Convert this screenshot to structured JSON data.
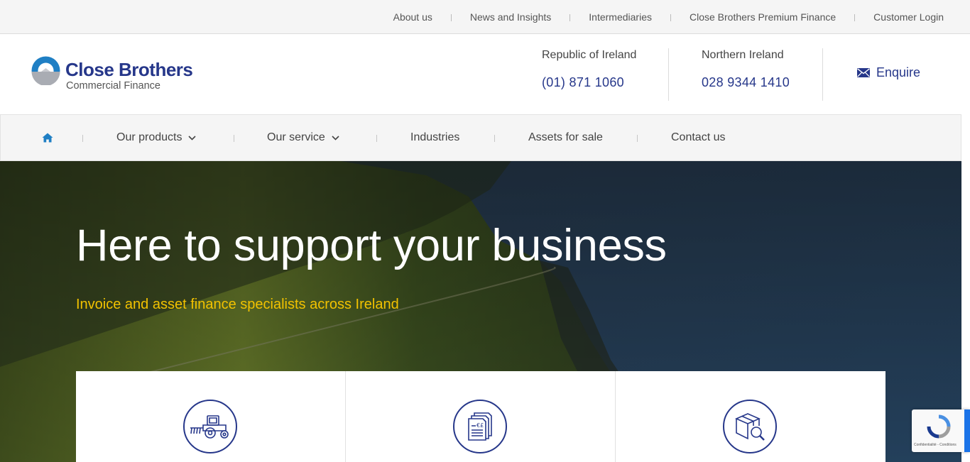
{
  "topbar": {
    "links": [
      "About us",
      "News and Insights",
      "Intermediaries",
      "Close Brothers Premium Finance",
      "Customer Login"
    ]
  },
  "logo": {
    "name": "Close Brothers",
    "subtitle": "Commercial Finance"
  },
  "contacts": {
    "roi": {
      "region": "Republic of Ireland",
      "phone": "(01) 871 1060"
    },
    "ni": {
      "region": "Northern Ireland",
      "phone": "028 9344 1410"
    }
  },
  "enquire": {
    "label": "Enquire",
    "icon": "envelope-icon"
  },
  "nav": {
    "home_icon": "home-icon",
    "products": "Our products",
    "service": "Our service",
    "industries": "Industries",
    "assets": "Assets for sale",
    "contact": "Contact us"
  },
  "hero": {
    "title": "Here to support your business",
    "subtitle": "Invoice and asset finance specialists across Ireland"
  },
  "cards": [
    {
      "icon": "tractor-icon"
    },
    {
      "icon": "invoice-documents-icon"
    },
    {
      "icon": "box-search-icon"
    }
  ],
  "recaptcha": {
    "terms": "Confidentialité - Conditions"
  },
  "colors": {
    "brand": "#26378a",
    "accent": "#f2c200",
    "topbar_bg": "#f5f5f5"
  }
}
